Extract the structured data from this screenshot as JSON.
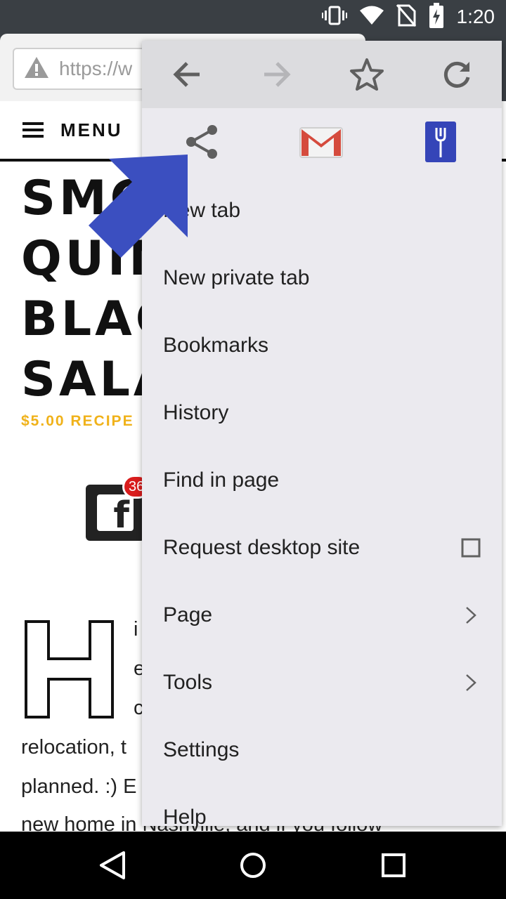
{
  "status_bar": {
    "time": "1:20",
    "icons": [
      "vibrate-icon",
      "wifi-icon",
      "no-sim-icon",
      "battery-charging-icon"
    ]
  },
  "browser": {
    "url": "https://w",
    "url_icon": "warning-icon"
  },
  "page": {
    "nav_menu_label": "MENU",
    "title_lines": [
      "SMC",
      "QUIN",
      "BLAC",
      "SALA"
    ],
    "recipe_tag": "$5.00 RECIPE",
    "facebook_count": "36",
    "drop_cap": "H",
    "body_fragments": {
      "line1": "i",
      "line2": "e",
      "line3": "c",
      "line4": "relocation, t",
      "line5": "planned. :) E",
      "line6": "new home in Nashville, and if you follow"
    }
  },
  "menu": {
    "top_actions": [
      "back-arrow-icon",
      "forward-arrow-icon",
      "star-icon",
      "reload-icon"
    ],
    "share_actions": [
      "share-icon",
      "gmail-icon",
      "fork-app-icon"
    ],
    "items": [
      {
        "label": "New tab"
      },
      {
        "label": "New private tab"
      },
      {
        "label": "Bookmarks"
      },
      {
        "label": "History"
      },
      {
        "label": "Find in page"
      },
      {
        "label": "Request desktop site",
        "trailing": "checkbox",
        "checked": false
      },
      {
        "label": "Page",
        "trailing": "chevron"
      },
      {
        "label": "Tools",
        "trailing": "chevron"
      },
      {
        "label": "Settings"
      },
      {
        "label": "Help"
      }
    ]
  },
  "colors": {
    "status_bar": "#3a3f44",
    "menu_bg": "#ebeaef",
    "menu_top_bg": "#dcdcdf",
    "accent_arrow": "#3b4fc0",
    "recipe_tag": "#f0b21a",
    "gmail_red": "#d54b3d",
    "fork_app_blue": "#3545b8"
  },
  "nav_bar": [
    "back-triangle-icon",
    "home-circle-icon",
    "recents-square-icon"
  ]
}
